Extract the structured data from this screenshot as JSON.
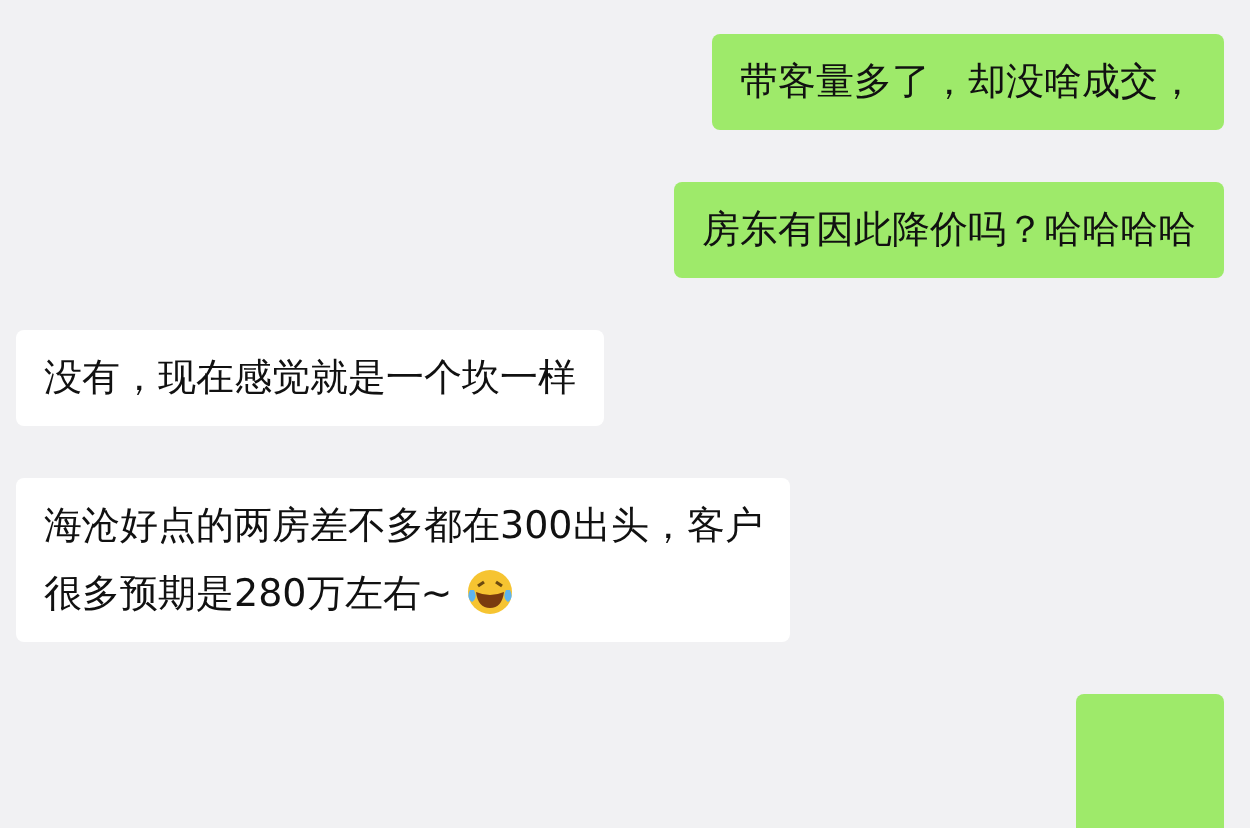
{
  "messages": [
    {
      "kind": "sent",
      "lines": [
        "带客量多了，却没啥成交，"
      ]
    },
    {
      "kind": "sent",
      "lines": [
        "房东有因此降价吗？哈哈哈哈"
      ]
    },
    {
      "kind": "received",
      "lines": [
        "没有，现在感觉就是一个坎一样"
      ]
    },
    {
      "kind": "received",
      "lines": [
        "海沧好点的两房差不多都在300出头，客户",
        "很多预期是280万左右~"
      ],
      "laughing_emoji": true
    },
    {
      "kind": "sent",
      "cut_off": true
    }
  ]
}
